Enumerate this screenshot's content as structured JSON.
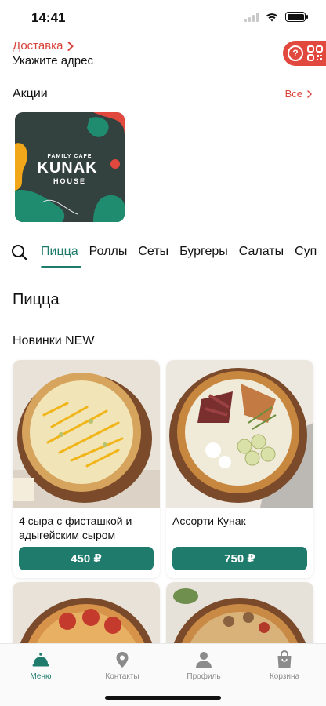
{
  "status": {
    "time": "14:41"
  },
  "header": {
    "delivery_label": "Доставка",
    "address_label": "Укажите адрес",
    "help_icon": "question-circle-icon",
    "qr_icon": "qr-code-icon",
    "accent": "#e1493f"
  },
  "promos": {
    "title": "Акции",
    "all_label": "Все",
    "card": {
      "top_text": "FAMILY CAFE",
      "logo_text": "KUNAK",
      "bottom_text": "HOUSE"
    }
  },
  "categories": {
    "search_icon": "search-icon",
    "items": [
      {
        "label": "Пицца",
        "active": true
      },
      {
        "label": "Роллы",
        "active": false
      },
      {
        "label": "Сеты",
        "active": false
      },
      {
        "label": "Бургеры",
        "active": false
      },
      {
        "label": "Салаты",
        "active": false
      },
      {
        "label": "Суп",
        "active": false
      }
    ]
  },
  "menu": {
    "title": "Пицца",
    "subtitle": "Новинки NEW",
    "products": [
      {
        "name": "4 сыра с фисташкой и адыгейским сыром",
        "price": "450 ₽"
      },
      {
        "name": "Ассорти Кунак",
        "price": "750 ₽"
      }
    ],
    "accent": "#1f7c6c"
  },
  "nav": {
    "items": [
      {
        "label": "Меню",
        "icon": "cloche-icon",
        "active": true
      },
      {
        "label": "Контакты",
        "icon": "location-pin-icon",
        "active": false
      },
      {
        "label": "Профиль",
        "icon": "user-icon",
        "active": false
      },
      {
        "label": "Корзина",
        "icon": "shopping-bag-icon",
        "active": false
      }
    ]
  }
}
